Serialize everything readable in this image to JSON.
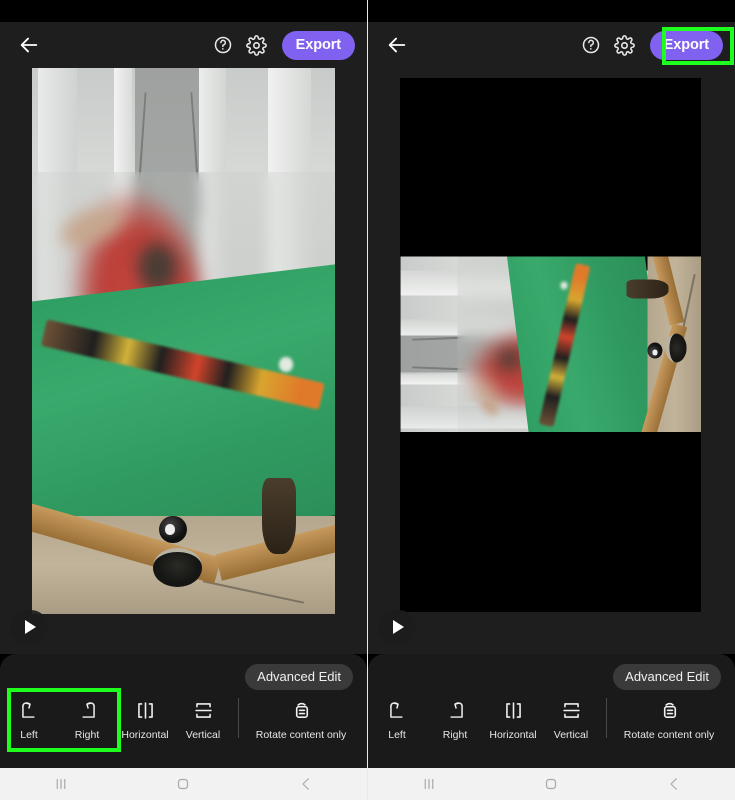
{
  "app": {
    "theme_dark_bg": "#1e1e1e",
    "accent": "#8061f0",
    "highlight_color": "#1eff1e"
  },
  "panels": [
    {
      "id": "before",
      "appbar": {
        "back_icon": "arrow-left-icon",
        "help_icon": "question-circle-icon",
        "settings_icon": "gear-icon",
        "export_label": "Export"
      },
      "player": {
        "play_icon": "play-icon"
      },
      "toolbar": {
        "advanced_edit_label": "Advanced Edit",
        "tools": [
          {
            "label": "Left",
            "icon": "rotate-left-icon"
          },
          {
            "label": "Right",
            "icon": "rotate-right-icon"
          },
          {
            "label": "Horizontal",
            "icon": "flip-horizontal-icon"
          },
          {
            "label": "Vertical",
            "icon": "flip-vertical-icon"
          },
          {
            "label": "Rotate content only",
            "icon": "rotate-content-icon"
          }
        ]
      },
      "navbar": {
        "recents_icon": "recents-icon",
        "home_icon": "home-icon",
        "back_icon": "back-chevron-icon"
      },
      "highlights": [
        "rotate-left-right-group"
      ]
    },
    {
      "id": "after",
      "appbar": {
        "back_icon": "arrow-left-icon",
        "help_icon": "question-circle-icon",
        "settings_icon": "gear-icon",
        "export_label": "Export"
      },
      "player": {
        "play_icon": "play-icon"
      },
      "toolbar": {
        "advanced_edit_label": "Advanced Edit",
        "tools": [
          {
            "label": "Left",
            "icon": "rotate-left-icon"
          },
          {
            "label": "Right",
            "icon": "rotate-right-icon"
          },
          {
            "label": "Horizontal",
            "icon": "flip-horizontal-icon"
          },
          {
            "label": "Vertical",
            "icon": "flip-vertical-icon"
          },
          {
            "label": "Rotate content only",
            "icon": "rotate-content-icon"
          }
        ]
      },
      "navbar": {
        "recents_icon": "recents-icon",
        "home_icon": "home-icon",
        "back_icon": "back-chevron-icon"
      },
      "highlights": [
        "export-button"
      ]
    }
  ]
}
